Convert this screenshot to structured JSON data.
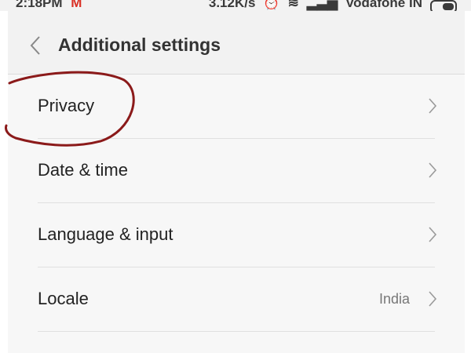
{
  "status_bar": {
    "time": "2:18PM",
    "notification_icon": "gmail-icon",
    "speed": "3.12K/s",
    "carrier": "Vodafone IN",
    "icons": [
      "alarm-off-icon",
      "wifi-icon",
      "signal-icon",
      "battery-icon"
    ]
  },
  "header": {
    "back_icon": "chevron-left-icon",
    "title": "Additional settings"
  },
  "settings": [
    {
      "label": "Privacy",
      "value": ""
    },
    {
      "label": "Date & time",
      "value": ""
    },
    {
      "label": "Language & input",
      "value": ""
    },
    {
      "label": "Locale",
      "value": "India"
    }
  ],
  "colors": {
    "annotation": "#8b1a1a",
    "gmail": "#d93025"
  }
}
